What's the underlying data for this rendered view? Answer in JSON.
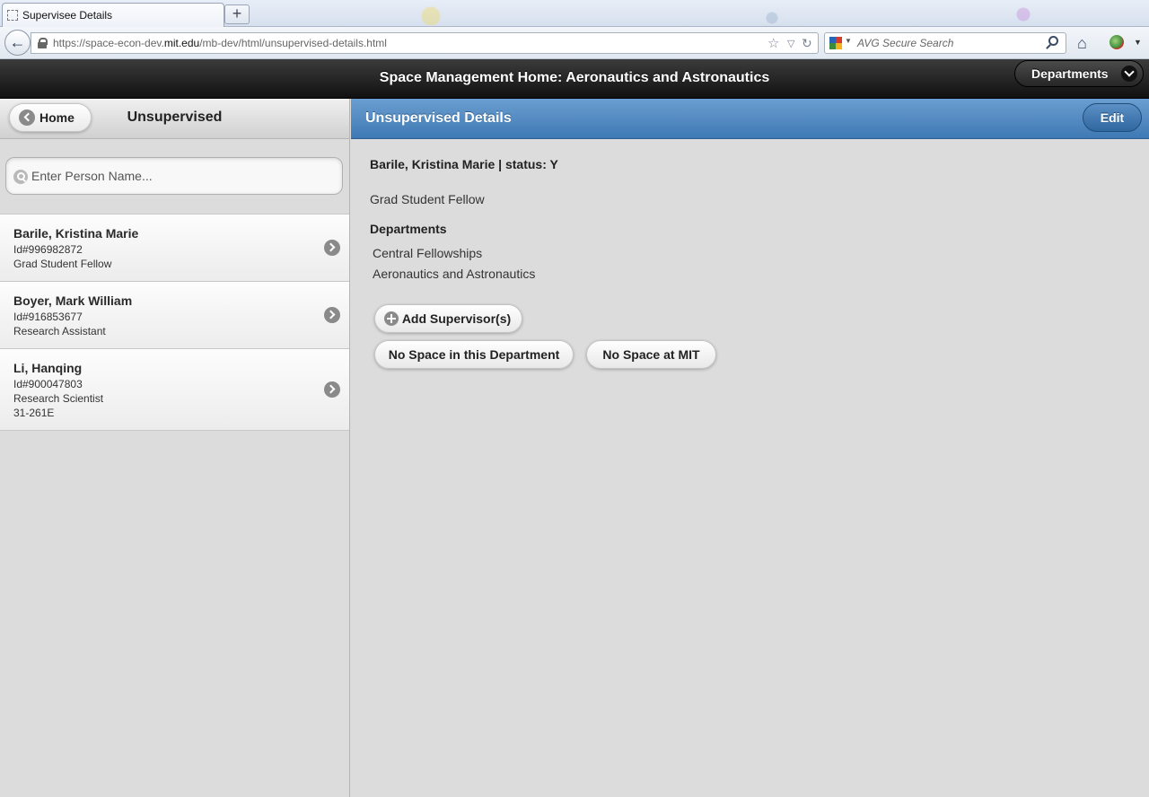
{
  "browser": {
    "tab_title": "Supervisee Details",
    "new_tab_symbol": "+",
    "url_prefix": "https://space-econ-dev.",
    "url_domain": "mit.edu",
    "url_path": "/mb-dev/html/unsupervised-details.html",
    "search_placeholder": "AVG Secure Search",
    "icons": [
      "page-icon",
      "back-arrow-icon",
      "lock-icon",
      "star-icon",
      "dropdown-icon",
      "reload-icon",
      "avg-icon",
      "magnify-icon",
      "home-icon",
      "addon-icon"
    ]
  },
  "header": {
    "title": "Space Management Home: Aeronautics and Astronautics",
    "departments_label": "Departments"
  },
  "left": {
    "home_label": "Home",
    "title": "Unsupervised",
    "search_placeholder": "Enter Person Name...",
    "people": [
      {
        "name": "Barile, Kristina Marie",
        "id": "Id#996982872",
        "role": "Grad Student Fellow"
      },
      {
        "name": "Boyer, Mark William",
        "id": "Id#916853677",
        "role": "Research Assistant"
      },
      {
        "name": "Li, Hanqing",
        "id": "Id#900047803",
        "role": "Research Scientist",
        "room": "31-261E"
      }
    ]
  },
  "detail": {
    "title": "Unsupervised Details",
    "edit_label": "Edit",
    "heading": "Barile, Kristina Marie | status: Y",
    "role": "Grad Student Fellow",
    "departments_label": "Departments",
    "departments": [
      "Central Fellowships",
      "Aeronautics and Astronautics"
    ],
    "add_supervisor_label": "Add Supervisor(s)",
    "no_space_dept_label": "No Space in this Department",
    "no_space_mit_label": "No Space at MIT"
  },
  "colors": {
    "header_dark": "#1a1a1a",
    "detail_header_blue": "#4f88c2",
    "background": "#dcdcdc"
  }
}
